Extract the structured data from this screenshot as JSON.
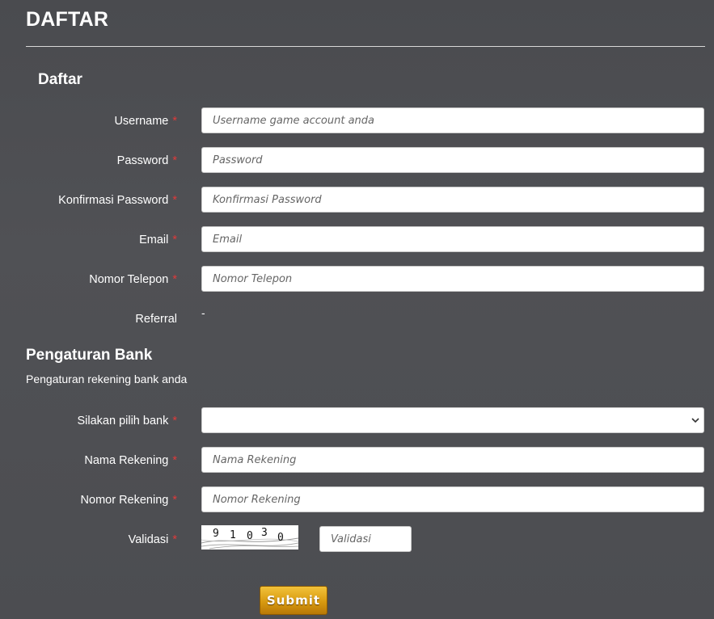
{
  "header": {
    "title": "DAFTAR"
  },
  "daftar_section": {
    "title": "Daftar"
  },
  "fields": {
    "username": {
      "label": "Username",
      "required": "*",
      "placeholder": "Username game account anda",
      "value": ""
    },
    "password": {
      "label": "Password",
      "required": "*",
      "placeholder": "Password",
      "value": ""
    },
    "confirm_password": {
      "label": "Konfirmasi Password",
      "required": "*",
      "placeholder": "Konfirmasi Password",
      "value": ""
    },
    "email": {
      "label": "Email",
      "required": "*",
      "placeholder": "Email",
      "value": ""
    },
    "phone": {
      "label": "Nomor Telepon",
      "required": "*",
      "placeholder": "Nomor Telepon",
      "value": ""
    },
    "referral": {
      "label": "Referral",
      "value": "-"
    }
  },
  "bank_section": {
    "title": "Pengaturan Bank",
    "description": "Pengaturan rekening bank anda",
    "bank_select": {
      "label": "Silakan pilih bank",
      "required": "*",
      "selected": ""
    },
    "account_name": {
      "label": "Nama Rekening",
      "required": "*",
      "placeholder": "Nama Rekening",
      "value": ""
    },
    "account_number": {
      "label": "Nomor Rekening",
      "required": "*",
      "placeholder": "Nomor Rekening",
      "value": ""
    }
  },
  "validation": {
    "label": "Validasi",
    "required": "*",
    "captcha_digits": [
      "9",
      "1",
      "0",
      "3",
      "0"
    ],
    "placeholder": "Validasi",
    "value": ""
  },
  "submit": {
    "label": "Submit"
  },
  "colors": {
    "required": "#e03a3a",
    "submit": "#d89a10",
    "background": "#4c4d51"
  },
  "icons": {
    "select_arrow": "chevron-down-icon"
  }
}
